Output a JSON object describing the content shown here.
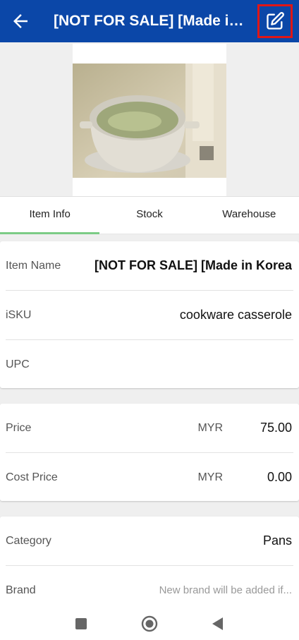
{
  "header": {
    "title": "[NOT FOR SALE]  [Made in Korea] Ceramic Cookware Casserole",
    "back_icon": "arrow-left-icon",
    "edit_icon": "edit-square-icon",
    "highlight_color": "#e01616",
    "bar_color": "#0b47a8"
  },
  "tabs": [
    {
      "label": "Item Info",
      "active": true
    },
    {
      "label": "Stock",
      "active": false
    },
    {
      "label": "Warehouse",
      "active": false
    }
  ],
  "item_info": {
    "item_name_label": "Item Name",
    "item_name_value": "[NOT FOR SALE]  [Made in Korea]",
    "sku_label": "iSKU",
    "sku_value": "cookware casserole",
    "upc_label": "UPC",
    "upc_value": ""
  },
  "pricing": {
    "price_label": "Price",
    "price_currency": "MYR",
    "price_value": "75.00",
    "cost_label": "Cost Price",
    "cost_currency": "MYR",
    "cost_value": "0.00"
  },
  "classification": {
    "category_label": "Category",
    "category_value": "Pans",
    "brand_label": "Brand",
    "brand_placeholder": "New brand will be added if..."
  },
  "navbar": {
    "recents_icon": "square-icon",
    "home_icon": "circle-home-icon",
    "back_icon": "triangle-back-icon"
  }
}
